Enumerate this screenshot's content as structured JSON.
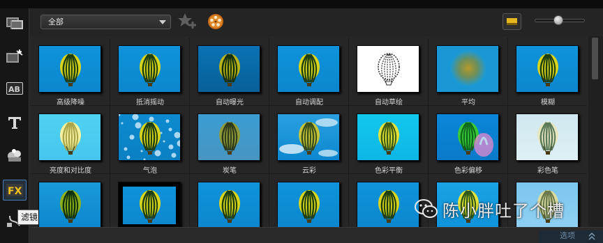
{
  "toolbar": {
    "filter_dropdown": {
      "selected": "全部"
    },
    "add_favorite_icon": "star-plus-icon",
    "reel_icon": "film-reel-icon",
    "view_mode_icon": "thumbnail-view-icon",
    "thumb_size_slider": {
      "level": 0.45
    }
  },
  "sidebar": {
    "items": [
      {
        "icon": "media-icon"
      },
      {
        "icon": "transition-icon"
      },
      {
        "icon": "title-ab-icon"
      },
      {
        "icon": "text-t-icon"
      },
      {
        "icon": "graphics-icon"
      },
      {
        "icon": "fx-filter-icon",
        "active": true
      },
      {
        "icon": "path-icon"
      }
    ],
    "tooltip": "滤镜"
  },
  "effects": [
    {
      "label": "高级降噪",
      "style": "normal"
    },
    {
      "label": "抵消摇动",
      "style": "normal"
    },
    {
      "label": "自动曝光",
      "style": "dark"
    },
    {
      "label": "自动调配",
      "style": "normal"
    },
    {
      "label": "自动草绘",
      "style": "sketch"
    },
    {
      "label": "平均",
      "style": "blur"
    },
    {
      "label": "模糊",
      "style": "normal"
    },
    {
      "label": "亮度和对比度",
      "style": "bright"
    },
    {
      "label": "气泡",
      "style": "bubble"
    },
    {
      "label": "炭笔",
      "style": "charcoal"
    },
    {
      "label": "云彩",
      "style": "cloud"
    },
    {
      "label": "色彩平衡",
      "style": "cyan"
    },
    {
      "label": "色彩偏移",
      "style": "shift"
    },
    {
      "label": "彩色笔",
      "style": "pen"
    },
    {
      "label": "",
      "style": "tiles"
    },
    {
      "label": "",
      "style": "frame"
    },
    {
      "label": "",
      "style": "normal"
    },
    {
      "label": "",
      "style": "normal"
    },
    {
      "label": "",
      "style": "normal"
    },
    {
      "label": "",
      "style": "light"
    },
    {
      "label": "",
      "style": "pale"
    }
  ],
  "bottom": {
    "options_label": "选项"
  },
  "watermark": {
    "text": "陈小胖吐了个槽"
  },
  "colors": {
    "accent": "#4a7fb6",
    "thumb_blue": "#0f93da",
    "balloon_yellow": "#d9d51c",
    "balloon_green": "#234a12"
  }
}
